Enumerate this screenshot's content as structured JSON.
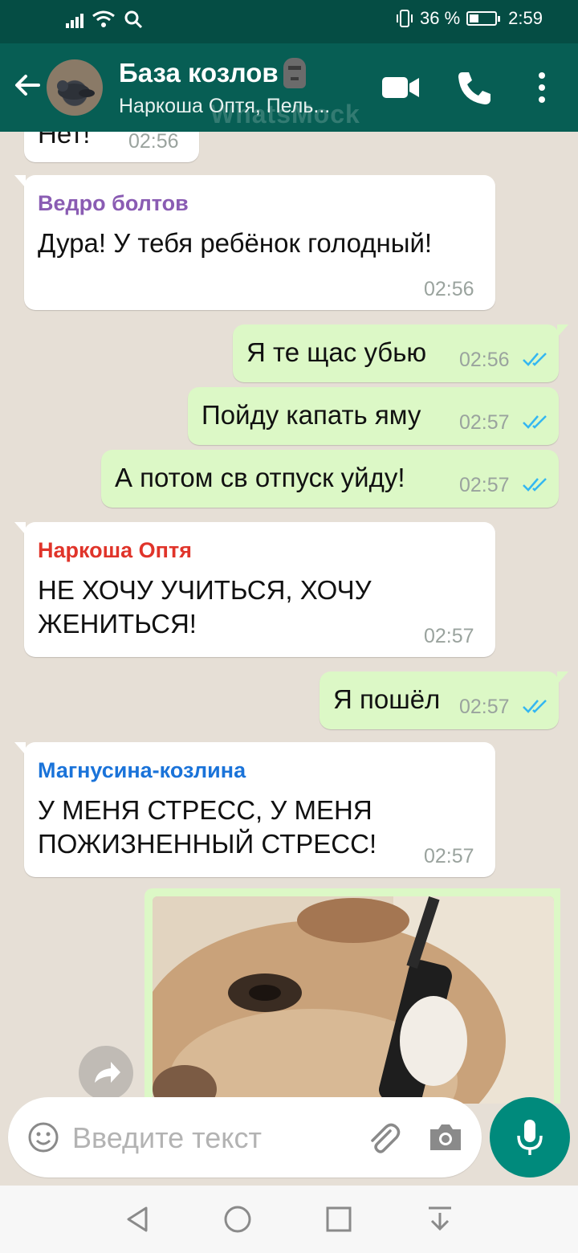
{
  "status_bar": {
    "battery_percent": "36 %",
    "battery_level": 0.36,
    "time": "2:59"
  },
  "header": {
    "title": "База козлов",
    "subtitle": "Наркоша Оптя, Пель...",
    "watermark": "WhatsMock",
    "emoji_icon": "moai-icon"
  },
  "messages": [
    {
      "type": "in",
      "text": "Нет!",
      "time": "02:56"
    },
    {
      "type": "in",
      "sender": "Ведро болтов",
      "sender_color": "#8a5cb3",
      "text": "Дура! У тебя ребёнок голодный!",
      "time": "02:56"
    },
    {
      "type": "out",
      "text": "Я те щас убью",
      "time": "02:56",
      "status": "read"
    },
    {
      "type": "out",
      "text": "Пойду капать яму",
      "time": "02:57",
      "status": "read"
    },
    {
      "type": "out",
      "text": "А потом св отпуск уйду!",
      "time": "02:57",
      "status": "read"
    },
    {
      "type": "in",
      "sender": "Наркоша Оптя",
      "sender_color": "#e0342a",
      "text_lines": [
        "НЕ ХОЧУ УЧИТЬСЯ, ХОЧУ",
        "ЖЕНИТЬСЯ!"
      ],
      "time": "02:57"
    },
    {
      "type": "out",
      "text": "Я пошёл",
      "time": "02:57",
      "status": "read"
    },
    {
      "type": "in",
      "sender": "Магнусина-козлина",
      "sender_color": "#1a73d9",
      "text_lines": [
        "У МЕНЯ СТРЕСС, У МЕНЯ",
        "ПОЖИЗНЕННЫЙ СТРЕСС!"
      ],
      "time": "02:57"
    },
    {
      "type": "out_image",
      "image": "dog-on-phone"
    }
  ],
  "input": {
    "placeholder": "Введите текст"
  },
  "colors": {
    "header": "#075e54",
    "status_bar": "#054d44",
    "outgoing": "#dcf8c6",
    "read_ticks": "#34b7f1",
    "mic_button": "#008a7c"
  }
}
